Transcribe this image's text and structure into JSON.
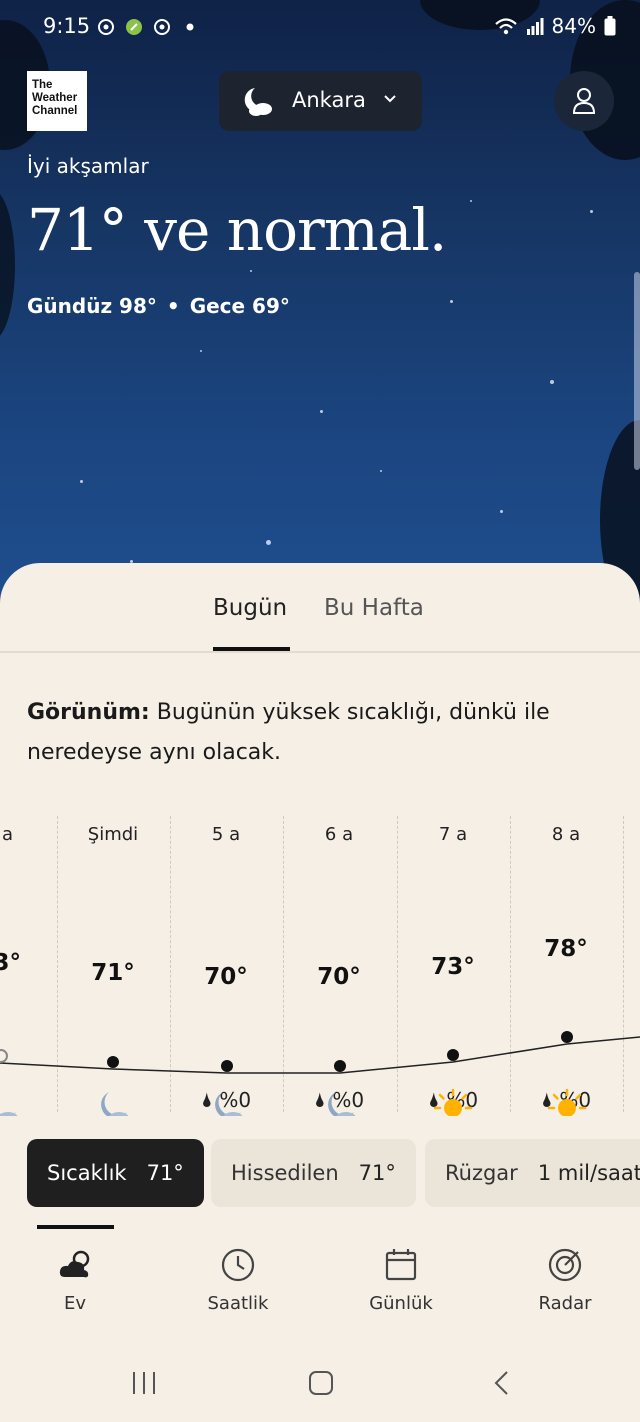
{
  "status_bar": {
    "time": "9:15",
    "battery": "84%"
  },
  "header": {
    "logo_lines": [
      "The",
      "Weather",
      "Channel"
    ],
    "location": "Ankara"
  },
  "hero": {
    "greeting": "İyi akşamlar",
    "headline": "71° ve normal.",
    "day_label": "Gündüz 98°",
    "night_label": "Gece 69°"
  },
  "tabs": {
    "today": "Bugün",
    "week": "Bu Hafta"
  },
  "outlook": {
    "label": "Görünüm:",
    "text": " Bugünün yüksek sıcaklığı, dünkü ile neredeyse aynı olacak."
  },
  "hourly": [
    {
      "time": "a",
      "temp": "3°",
      "icon": "moon-cloud-icon",
      "precip": ""
    },
    {
      "time": "Şimdi",
      "temp": "71°",
      "icon": "moon-cloud-icon",
      "precip": ""
    },
    {
      "time": "5 a",
      "temp": "70°",
      "icon": "moon-cloud-icon",
      "precip": "%0"
    },
    {
      "time": "6 a",
      "temp": "70°",
      "icon": "moon-cloud-icon",
      "precip": "%0"
    },
    {
      "time": "7 a",
      "temp": "73°",
      "icon": "sun-icon",
      "precip": "%0"
    },
    {
      "time": "8 a",
      "temp": "78°",
      "icon": "sun-icon",
      "precip": "%0"
    }
  ],
  "chips": [
    {
      "label": "Sıcaklık",
      "value": "71°"
    },
    {
      "label": "Hissedilen",
      "value": "71°"
    },
    {
      "label": "Rüzgar",
      "value": "1 mil/saat"
    }
  ],
  "nav": {
    "home": "Ev",
    "hourly": "Saatlik",
    "daily": "Günlük",
    "radar": "Radar"
  },
  "colors": {
    "sky_top": "#0f2247",
    "sky_bottom": "#1f4f8f",
    "sheet_bg": "#f5efe6",
    "sun": "#ffb300",
    "moon_icon": "#8ea8c4"
  }
}
